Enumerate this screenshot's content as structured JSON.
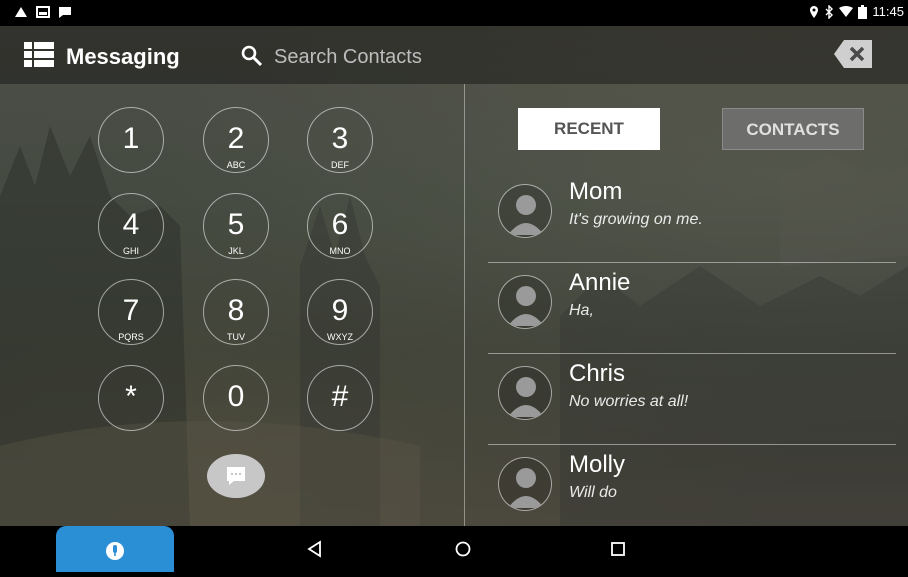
{
  "status_bar": {
    "time": "11:45"
  },
  "header": {
    "title": "Messaging",
    "search": {
      "placeholder": "Search Contacts",
      "value": ""
    }
  },
  "dialpad": {
    "keys": [
      {
        "digit": "1",
        "letters": ""
      },
      {
        "digit": "2",
        "letters": "ABC"
      },
      {
        "digit": "3",
        "letters": "DEF"
      },
      {
        "digit": "4",
        "letters": "GHI"
      },
      {
        "digit": "5",
        "letters": "JKL"
      },
      {
        "digit": "6",
        "letters": "MNO"
      },
      {
        "digit": "7",
        "letters": "PQRS"
      },
      {
        "digit": "8",
        "letters": "TUV"
      },
      {
        "digit": "9",
        "letters": "WXYZ"
      },
      {
        "digit": "*",
        "letters": ""
      },
      {
        "digit": "0",
        "letters": ""
      },
      {
        "digit": "#",
        "letters": ""
      }
    ]
  },
  "tabs": {
    "recent": "RECENT",
    "contacts": "CONTACTS",
    "active": "recent"
  },
  "contacts": [
    {
      "name": "Mom",
      "message": "It's growing on me."
    },
    {
      "name": "Annie",
      "message": "Ha,"
    },
    {
      "name": "Chris",
      "message": "No worries at all!"
    },
    {
      "name": "Molly",
      "message": "Will do"
    }
  ],
  "colors": {
    "accent": "#2b8fd6",
    "tab_active_bg": "#ffffff",
    "tab_inactive_bg": "#6d6d6b"
  },
  "icons": {
    "menu": "list-menu-icon",
    "search": "search-icon",
    "clear": "backspace-clear-icon",
    "compose": "chat-bubble-icon",
    "mic": "microphone-icon",
    "back": "back-triangle-icon",
    "home": "home-circle-icon",
    "recents": "recents-square-icon"
  }
}
